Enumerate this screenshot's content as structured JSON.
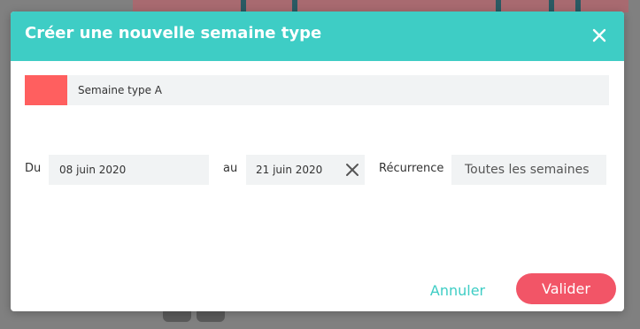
{
  "modal": {
    "title": "Créer une nouvelle semaine type",
    "close_icon": "close-icon"
  },
  "week": {
    "color": "#ff5f5f",
    "name": "Semaine type A"
  },
  "period": {
    "from_label": "Du",
    "from_date": "08 juin 2020",
    "to_label": "au",
    "to_date": "21 juin 2020",
    "clear_icon": "close-icon"
  },
  "recurrence": {
    "label": "Récurrence",
    "value": "Toutes les semaines"
  },
  "actions": {
    "cancel_label": "Annuler",
    "validate_label": "Valider"
  },
  "colors": {
    "header": "#3ecdc5",
    "accent": "#3ecdc5",
    "primary_button": "#f25567"
  }
}
